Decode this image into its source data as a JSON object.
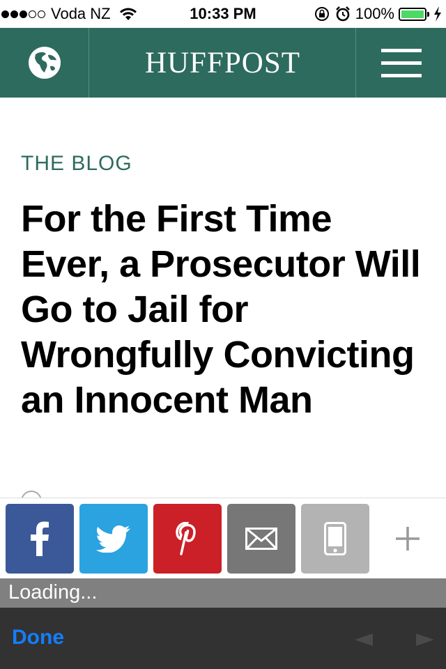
{
  "status_bar": {
    "carrier": "Voda NZ",
    "signal_bars": 3,
    "time": "10:33 PM",
    "battery_percent": "100%"
  },
  "header": {
    "logo": "HUFFPOST",
    "background_color": "#2d6b5e"
  },
  "article": {
    "section": "THE BLOG",
    "headline": "For the First Time Ever, a Prosecutor Will Go to Jail for Wrongfully Convicting an Innocent Man"
  },
  "share_bar": {
    "buttons": [
      {
        "name": "facebook",
        "icon": "facebook-icon",
        "color": "#3b5998"
      },
      {
        "name": "twitter",
        "icon": "twitter-icon",
        "color": "#2aa3e0"
      },
      {
        "name": "pinterest",
        "icon": "pinterest-icon",
        "color": "#cb2027"
      },
      {
        "name": "email",
        "icon": "envelope-icon",
        "color": "#777777"
      },
      {
        "name": "sms",
        "icon": "phone-icon",
        "color": "#b3b3b3"
      },
      {
        "name": "more",
        "icon": "plus-icon",
        "color": "#999999"
      }
    ]
  },
  "loading": {
    "text": "Loading..."
  },
  "toolbar": {
    "done_label": "Done",
    "accent_color": "#147efb"
  }
}
